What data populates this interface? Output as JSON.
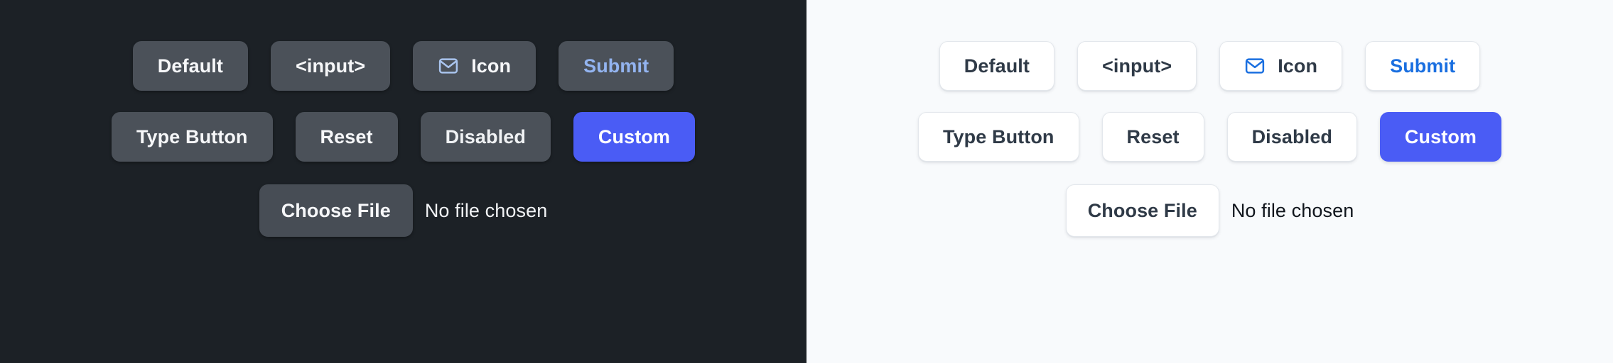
{
  "theme_colors": {
    "dark_background": "#1c2126",
    "light_background": "#f8fafc",
    "dark_button_fill": "#4b5159",
    "light_button_fill": "#ffffff",
    "light_button_border": "#e3e7ec",
    "dark_button_text": "#f6f7f9",
    "light_button_text": "#2f3a47",
    "dark_accent_text": "#93b4f0",
    "light_accent_text": "#1a6fe0",
    "custom_button_fill": "#4a5cf5",
    "custom_button_text": "#ffffff",
    "dark_icon_stroke": "#a9c4ee",
    "light_icon_stroke": "#1a6fe0"
  },
  "panels": {
    "dark": {
      "row_one": [
        {
          "label": "Default",
          "name": "default-button",
          "icon": null,
          "variant": "default",
          "interactable": true
        },
        {
          "label": "<input>",
          "name": "input-button",
          "icon": null,
          "variant": "default",
          "interactable": true
        },
        {
          "label": "Icon",
          "name": "icon-button",
          "icon": "mail-icon",
          "variant": "default",
          "interactable": true
        },
        {
          "label": "Submit",
          "name": "submit-button",
          "icon": null,
          "variant": "accent",
          "interactable": true
        }
      ],
      "row_two": [
        {
          "label": "Type Button",
          "name": "type-button",
          "icon": null,
          "variant": "default",
          "interactable": true
        },
        {
          "label": "Reset",
          "name": "reset-button",
          "icon": null,
          "variant": "default",
          "interactable": true
        },
        {
          "label": "Disabled",
          "name": "disabled-button",
          "icon": null,
          "variant": "disabled",
          "interactable": false
        },
        {
          "label": "Custom",
          "name": "custom-button",
          "icon": null,
          "variant": "custom",
          "interactable": true
        }
      ],
      "file_input": {
        "button_label": "Choose File",
        "status_text": "No file chosen"
      }
    },
    "light": {
      "row_one": [
        {
          "label": "Default",
          "name": "default-button",
          "icon": null,
          "variant": "default",
          "interactable": true
        },
        {
          "label": "<input>",
          "name": "input-button",
          "icon": null,
          "variant": "default",
          "interactable": true
        },
        {
          "label": "Icon",
          "name": "icon-button",
          "icon": "mail-icon",
          "variant": "default",
          "interactable": true
        },
        {
          "label": "Submit",
          "name": "submit-button",
          "icon": null,
          "variant": "accent",
          "interactable": true
        }
      ],
      "row_two": [
        {
          "label": "Type Button",
          "name": "type-button",
          "icon": null,
          "variant": "default",
          "interactable": true
        },
        {
          "label": "Reset",
          "name": "reset-button",
          "icon": null,
          "variant": "default",
          "interactable": true
        },
        {
          "label": "Disabled",
          "name": "disabled-button",
          "icon": null,
          "variant": "disabled",
          "interactable": false
        },
        {
          "label": "Custom",
          "name": "custom-button",
          "icon": null,
          "variant": "custom",
          "interactable": true
        }
      ],
      "file_input": {
        "button_label": "Choose File",
        "status_text": "No file chosen"
      }
    }
  }
}
